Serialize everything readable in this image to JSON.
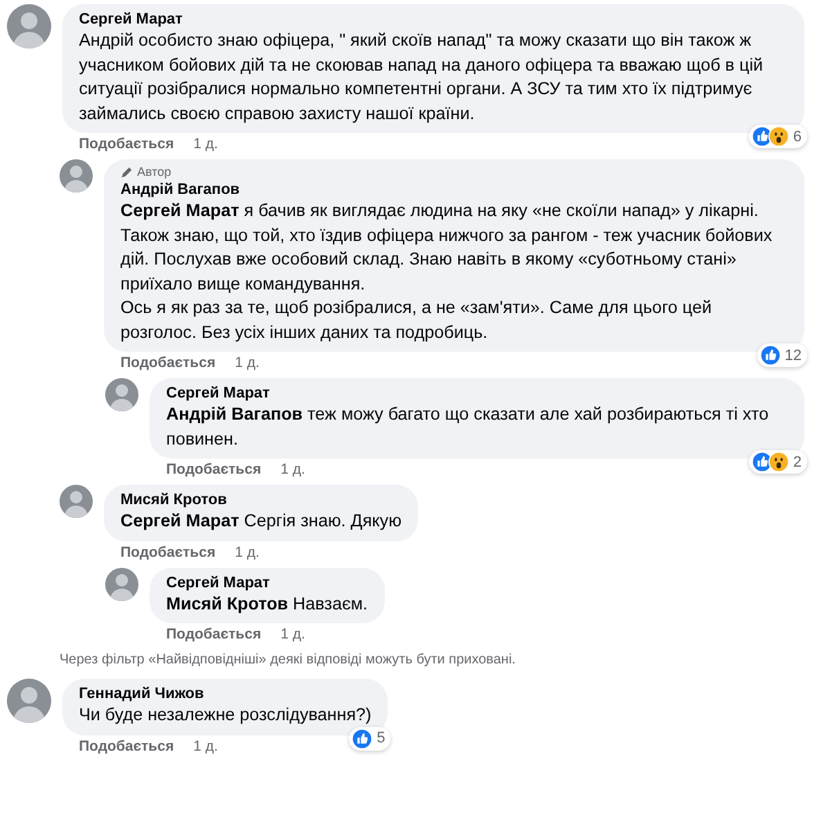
{
  "comments": [
    {
      "author": "Сергей Марат",
      "text": "Андрій особисто знаю офіцера, \" який скоїв напад\" та можу сказати що він також ж учасником бойових дій та не скоював напад на даного офіцера та вважаю щоб в цій ситуації розібралися нормально компетентні органи. А ЗСУ та тим хто їх підтримує займались своєю справою захисту нашої країни.",
      "reactions": [
        {
          "kind": "like"
        },
        {
          "kind": "wow"
        }
      ],
      "reaction_count": "6",
      "like_label": "Подобається",
      "time": "1 д.",
      "children": [
        {
          "author": "Андрій Вагапов",
          "author_badge": "Автор",
          "text": "**Сергей Марат** я бачив як виглядає людина на яку «не скоїли напад» у лікарні. Також знаю, що той, хто їздив офіцера нижчого за рангом - теж учасник бойових дій. Послухав вже особовий склад. Знаю навіть в якому «суботньому стані» приїхало вище командування.\nОсь я як раз за те, щоб розібралися, а не «зам'яти». Саме для цього цей розголос. Без усіх інших даних та подробиць.",
          "reactions": [
            {
              "kind": "like"
            }
          ],
          "reaction_count": "12",
          "like_label": "Подобається",
          "time": "1 д.",
          "children": [
            {
              "author": "Сергей Марат",
              "text": "**Андрій Вагапов** теж можу багато що сказати але хай розбираються ті хто повинен.",
              "reactions": [
                {
                  "kind": "like"
                },
                {
                  "kind": "wow"
                }
              ],
              "reaction_count": "2",
              "like_label": "Подобається",
              "time": "1 д."
            }
          ]
        },
        {
          "author": "Мисяй Кротов",
          "text": "**Сергей Марат** Сергія знаю. Дякую",
          "like_label": "Подобається",
          "time": "1 д.",
          "children": [
            {
              "author": "Сергей Марат",
              "text": "**Мисяй Кротов** Навзаєм.",
              "like_label": "Подобається",
              "time": "1 д."
            }
          ]
        }
      ],
      "filter_note": "Через фільтр «Найвідповідніші» деякі відповіді можуть бути приховані."
    },
    {
      "author": "Геннадий Чижов",
      "text": "Чи буде незалежне розслідування?)",
      "reactions": [
        {
          "kind": "like"
        }
      ],
      "reaction_count": "5",
      "like_label": "Подобається",
      "time": "1 д."
    }
  ]
}
